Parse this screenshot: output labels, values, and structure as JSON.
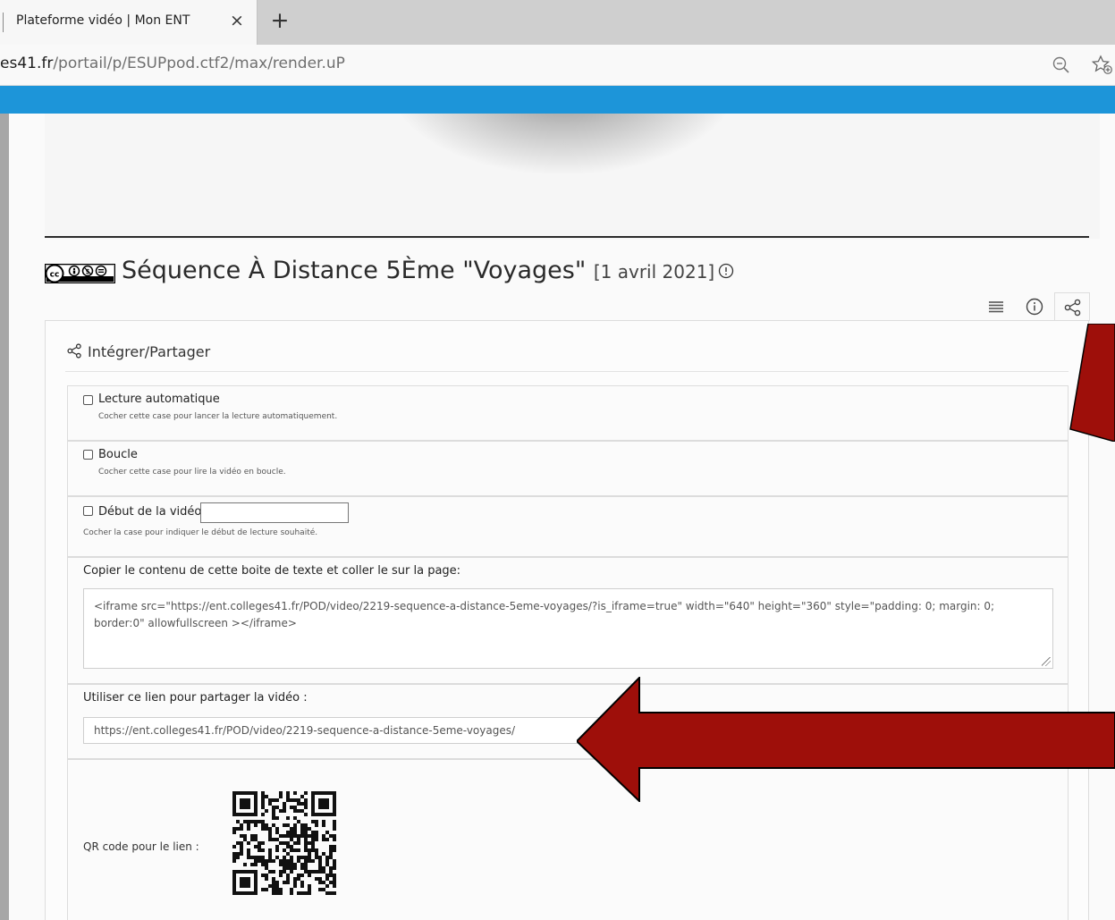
{
  "browser": {
    "tab_title": "Plateforme vidéo | Mon ENT",
    "tab_close_glyph": "×",
    "new_tab_glyph": "+",
    "url_host": "es41.fr",
    "url_path": "/portail/p/ESUPpod.ctf2/max/render.uP",
    "icons": [
      "zoom-out-icon",
      "favorite-star-icon"
    ],
    "accent_bar_color": "#1d95d9"
  },
  "video": {
    "license_icon": "creative-commons-by-nc-nd-icon",
    "title": "Séquence À Distance 5Ème \"Voyages\"",
    "date": "[1 avril 2021]",
    "toolbar_icons": [
      "list-menu-icon",
      "info-icon",
      "share-icon"
    ]
  },
  "share_panel": {
    "title": "Intégrer/Partager",
    "autoplay": {
      "label": "Lecture automatique",
      "help": "Cocher cette case pour lancer la lecture automatiquement.",
      "checked": false
    },
    "loop": {
      "label": "Boucle",
      "help": "Cocher cette case pour lire la vidéo en boucle.",
      "checked": false
    },
    "start": {
      "label": "Début de la vidéo",
      "value": "",
      "help": "Cocher la case pour indiquer le début de lecture souhaité.",
      "checked": false
    },
    "embed": {
      "label": "Copier le contenu de cette boite de texte et coller le sur la page:",
      "code": "<iframe src=\"https://ent.colleges41.fr/POD/video/2219-sequence-a-distance-5eme-voyages/?is_iframe=true\" width=\"640\" height=\"360\" style=\"padding: 0; margin: 0; border:0\" allowfullscreen ></iframe>"
    },
    "link": {
      "label": "Utiliser ce lien pour partager la vidéo :",
      "value": "https://ent.colleges41.fr/POD/video/2219-sequence-a-distance-5eme-voyages/"
    },
    "qr": {
      "label": "QR code pour le lien :"
    }
  },
  "annotations": {
    "arrow_color": "#9e0f0a"
  }
}
